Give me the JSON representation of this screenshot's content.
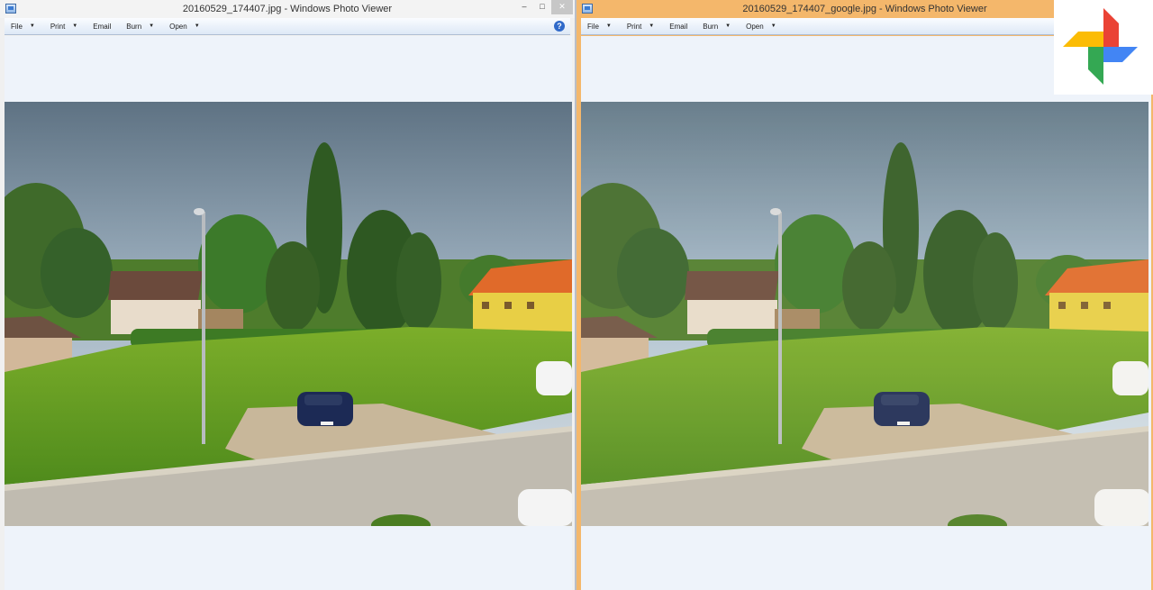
{
  "left_window": {
    "title": "20160529_174407.jpg - Windows Photo Viewer",
    "menus": [
      "File",
      "Print",
      "Email",
      "Burn",
      "Open"
    ],
    "help": "?",
    "controls": [
      "–",
      "□",
      "✕"
    ]
  },
  "right_window": {
    "title": "20160529_174407_google.jpg - Windows Photo Viewer",
    "menus": [
      "File",
      "Print",
      "Email",
      "Burn",
      "Open"
    ]
  },
  "colors": {
    "active_title": "#f4b76b",
    "inactive_title": "#f3f3f3",
    "canvas": "#eef3fa"
  },
  "logo": {
    "icon": "google-photos-pinwheel-icon"
  }
}
